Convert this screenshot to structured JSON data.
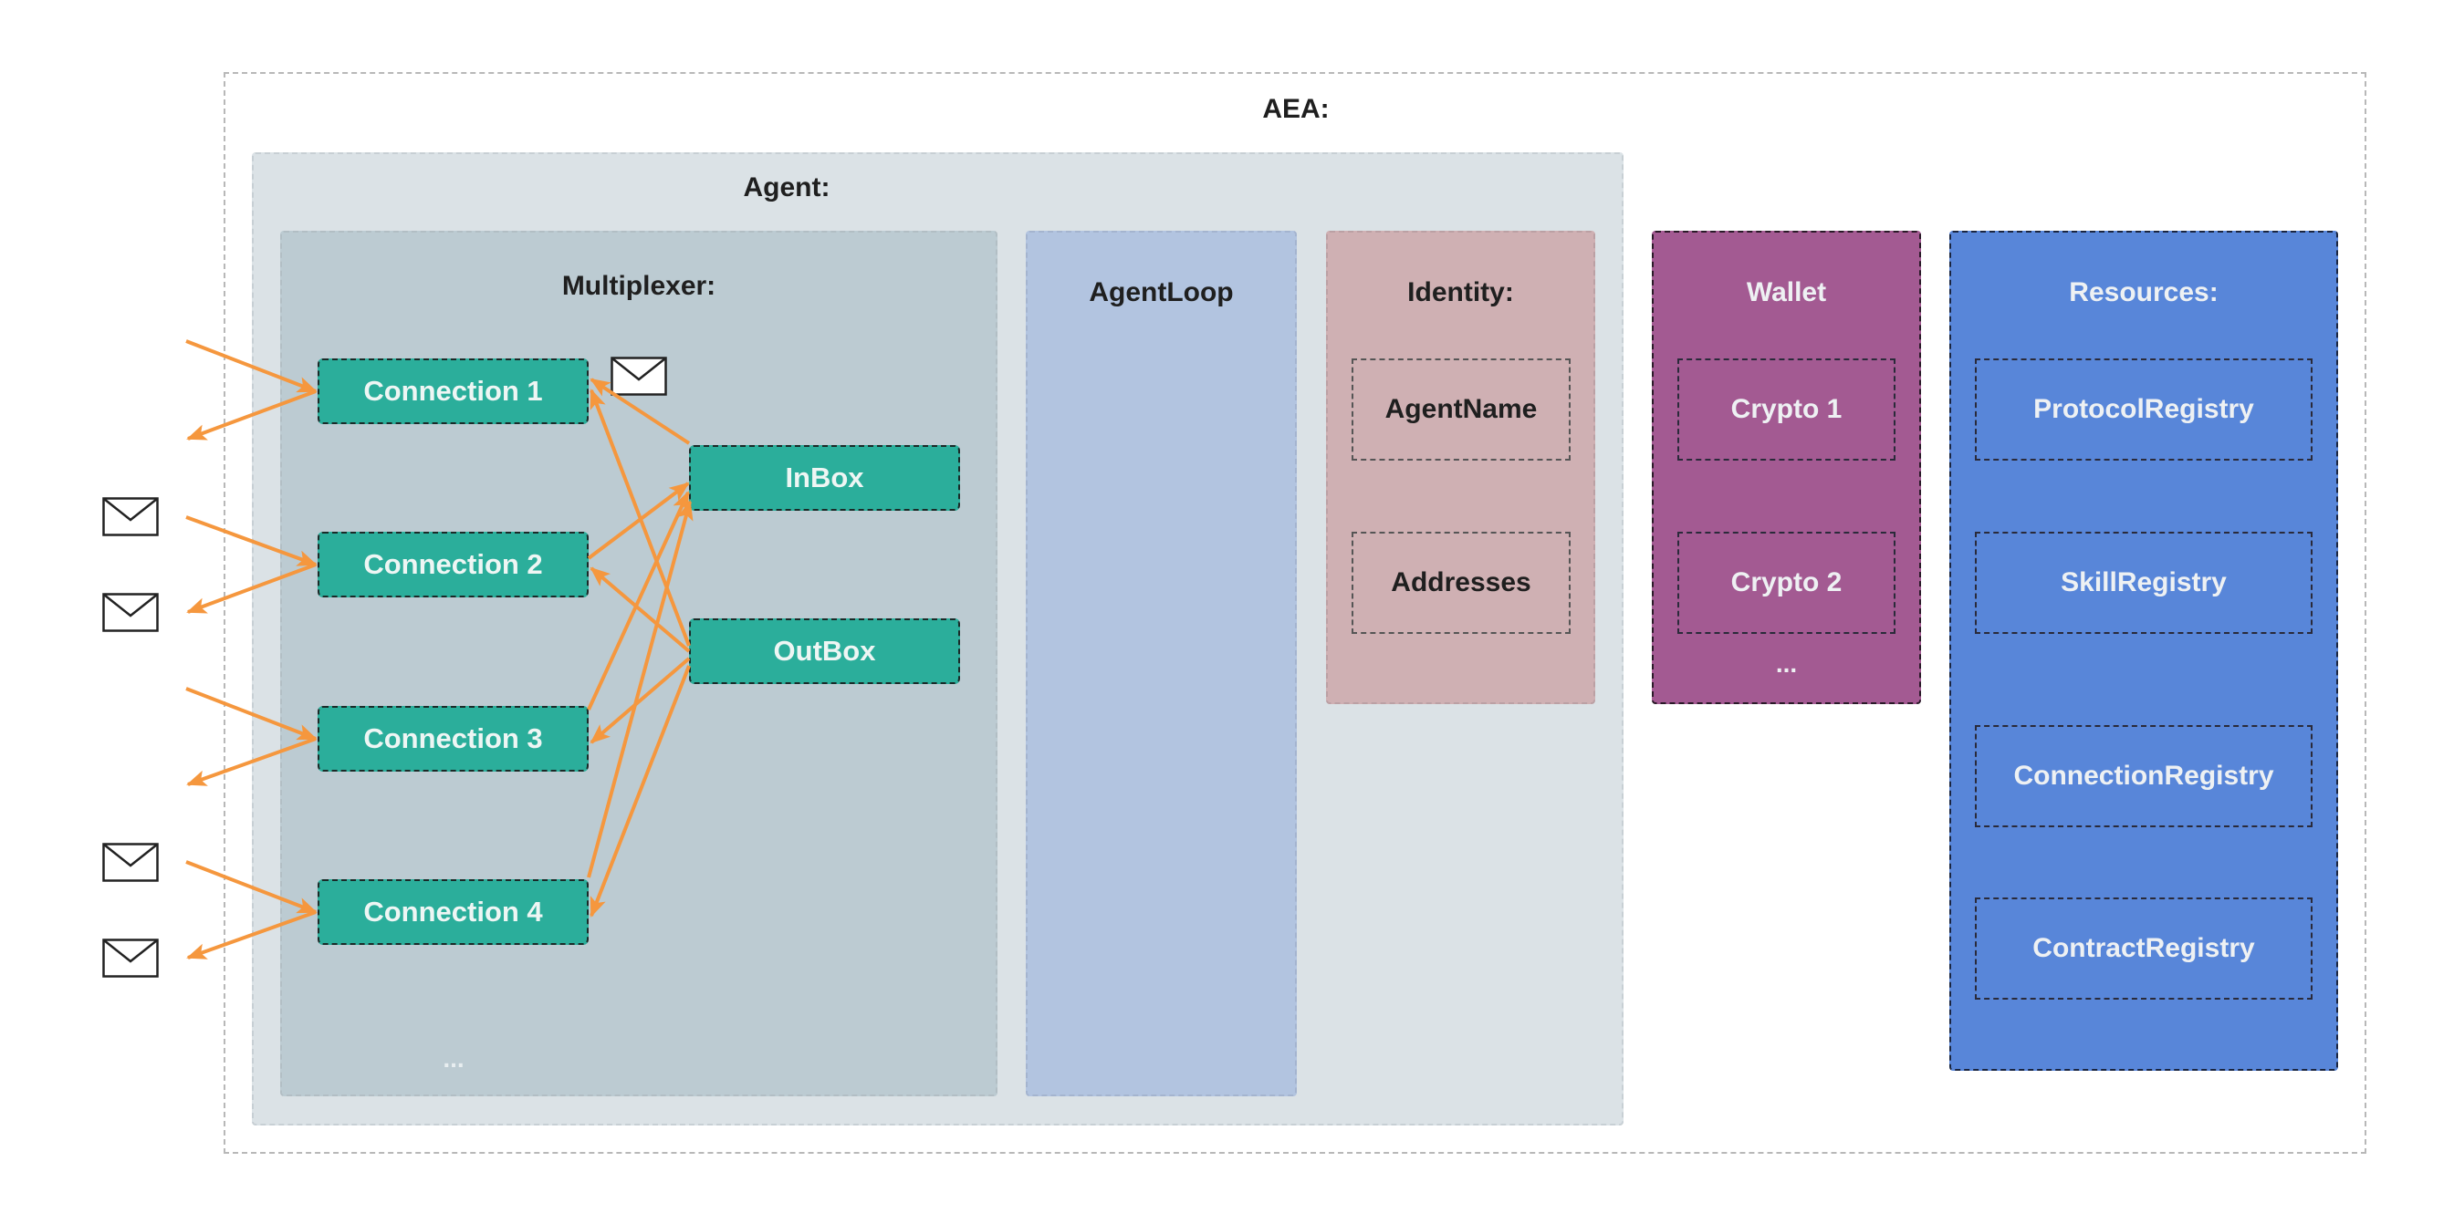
{
  "aea": {
    "title": "AEA:"
  },
  "agent": {
    "title": "Agent:"
  },
  "multiplexer": {
    "title": "Multiplexer:",
    "connections": [
      "Connection 1",
      "Connection 2",
      "Connection 3",
      "Connection 4"
    ],
    "inbox": "InBox",
    "outbox": "OutBox",
    "more": "..."
  },
  "agent_loop": {
    "title": "AgentLoop"
  },
  "identity": {
    "title": "Identity:",
    "items": [
      "AgentName",
      "Addresses"
    ]
  },
  "wallet": {
    "title": "Wallet",
    "items": [
      "Crypto 1",
      "Crypto 2"
    ],
    "more": "..."
  },
  "resources": {
    "title": "Resources:",
    "items": [
      "ProtocolRegistry",
      "SkillRegistry",
      "ConnectionRegistry",
      "ContractRegistry"
    ]
  },
  "icons": {
    "message": "envelope-icon",
    "flow": "arrow-icon"
  },
  "colors": {
    "arrow": "#f5973e",
    "connection": "#2bae9b",
    "agent_bg": "#dbe2e6",
    "multiplexer_bg": "#bccbd2",
    "agent_loop_bg": "#b2c4e0",
    "identity_bg": "#cfb0b3",
    "wallet_bg": "#a35a92",
    "resources_bg": "#5886d9"
  }
}
